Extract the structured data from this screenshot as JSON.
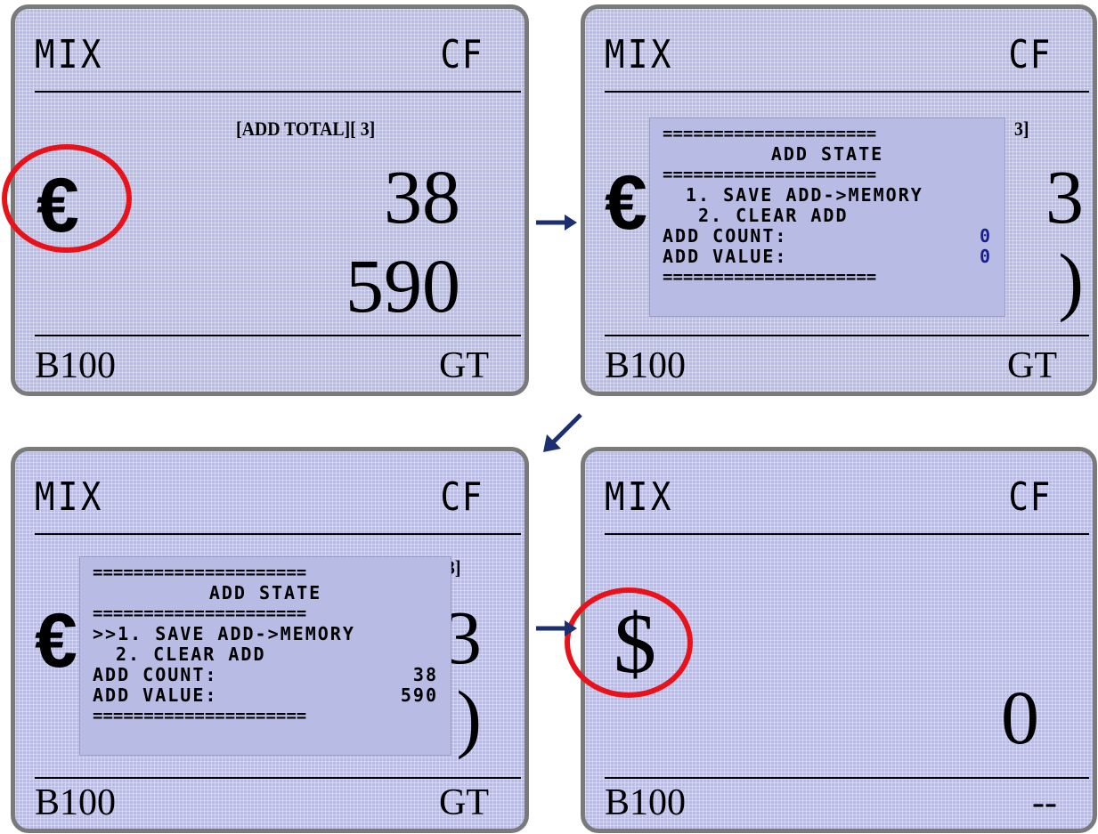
{
  "panels": [
    {
      "header_left": "MIX",
      "header_right": "CF",
      "subtitle": "[ADD TOTAL][    3]",
      "currency": "€",
      "count": "38",
      "value": "590",
      "footer_left": "B100",
      "footer_right": "GT"
    },
    {
      "header_left": "MIX",
      "header_right": "CF",
      "footer_left": "B100",
      "footer_right": "GT",
      "bg_currency": "€",
      "bg_digit_top": "3",
      "bg_digit_bottom": ")",
      "bg_bracket": "3]",
      "popup": {
        "rule": "=====================",
        "title": "ADD STATE",
        "option1": "1. SAVE   ADD->MEMORY",
        "option2": "2. CLEAR ADD",
        "count_label": "ADD COUNT:",
        "count_value": "0",
        "value_label": "ADD VALUE:",
        "value_value": "0"
      }
    },
    {
      "header_left": "MIX",
      "header_right": "CF",
      "footer_left": "B100",
      "footer_right": "GT",
      "bg_currency": "€",
      "bg_digit_top": "3",
      "bg_digit_bottom": ")",
      "bg_bracket": "3]",
      "popup": {
        "rule": "=====================",
        "title": "ADD STATE",
        "option1": ">>1. SAVE   ADD->MEMORY",
        "option2": "2. CLEAR ADD",
        "count_label": "ADD COUNT:",
        "count_value": "38",
        "value_label": "ADD VALUE:",
        "value_value": "590"
      }
    },
    {
      "header_left": "MIX",
      "header_right": "CF",
      "currency": "$",
      "value": "0",
      "footer_left": "B100",
      "footer_right": "--"
    }
  ],
  "colors": {
    "screen_bg": "#b9bce0",
    "frame": "#7a7a7a",
    "highlight_circle": "#e8131a",
    "arrow": "#1c2f6e"
  },
  "icons": [
    "right-arrow-icon",
    "down-left-arrow-icon",
    "right-arrow-icon"
  ]
}
